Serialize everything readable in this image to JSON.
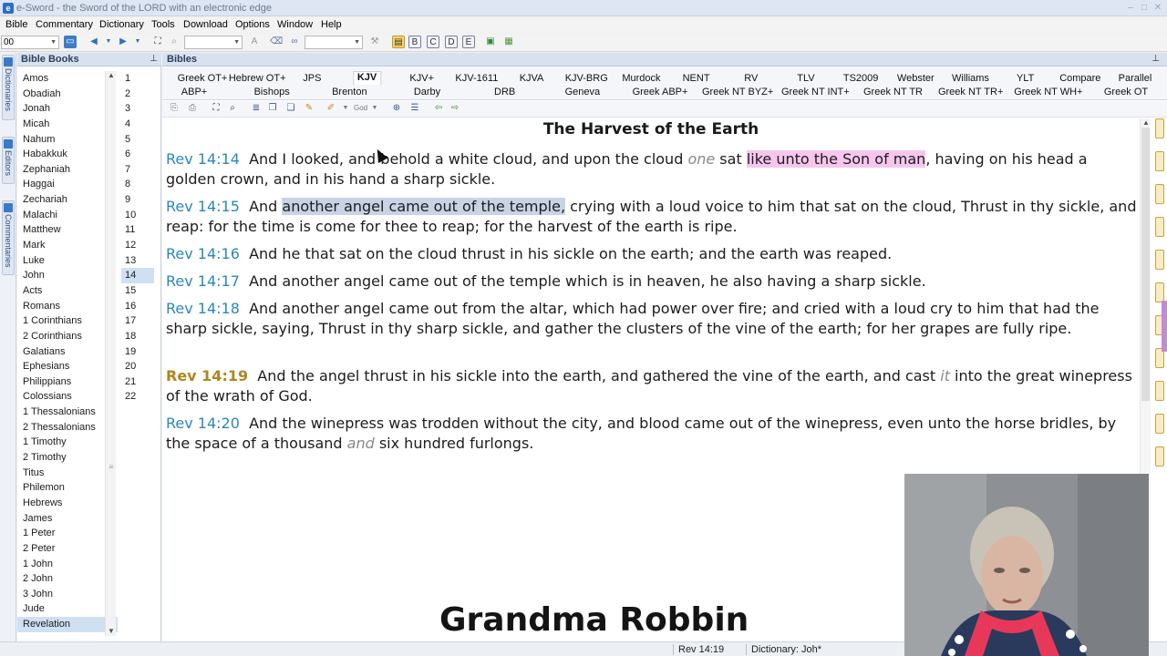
{
  "window": {
    "title": "e-Sword - the Sword of the LORD with an electronic edge",
    "controls": [
      "–",
      "□",
      "✕"
    ]
  },
  "menu": [
    "Bible",
    "Commentary",
    "Dictionary",
    "Tools",
    "Download",
    "Options",
    "Window",
    "Help"
  ],
  "toolbar": {
    "chapter_combo": "00",
    "search_combo": "",
    "translation_combo": ""
  },
  "side_tabs": [
    "Dictionaries",
    "Editors",
    "Commentaries"
  ],
  "book_panel": {
    "title": "Bible Books",
    "books": [
      "Amos",
      "Obadiah",
      "Jonah",
      "Micah",
      "Nahum",
      "Habakkuk",
      "Zephaniah",
      "Haggai",
      "Zechariah",
      "Malachi",
      "Matthew",
      "Mark",
      "Luke",
      "John",
      "Acts",
      "Romans",
      "1 Corinthians",
      "2 Corinthians",
      "Galatians",
      "Ephesians",
      "Philippians",
      "Colossians",
      "1 Thessalonians",
      "2 Thessalonians",
      "1 Timothy",
      "2 Timothy",
      "Titus",
      "Philemon",
      "Hebrews",
      "James",
      "1 Peter",
      "2 Peter",
      "1 John",
      "2 John",
      "3 John",
      "Jude",
      "Revelation"
    ],
    "selected_book": "Revelation",
    "chapters": [
      "1",
      "2",
      "3",
      "4",
      "5",
      "6",
      "7",
      "8",
      "9",
      "10",
      "11",
      "12",
      "13",
      "14",
      "15",
      "16",
      "17",
      "18",
      "19",
      "20",
      "21",
      "22"
    ],
    "selected_chapter": "14"
  },
  "bible_panel": {
    "title": "Bibles",
    "tabs_row1": [
      "Greek OT+",
      "Hebrew OT+",
      "JPS",
      "KJV",
      "KJV+",
      "KJV-1611",
      "KJVA",
      "KJV-BRG",
      "Murdock",
      "NENT",
      "RV",
      "TLV",
      "TS2009",
      "Webster",
      "Williams",
      "YLT",
      "Compare",
      "Parallel"
    ],
    "tabs_row2": [
      "ABP+",
      "Bishops",
      "Brenton",
      "Darby",
      "DRB",
      "Geneva",
      "Greek ABP+",
      "Greek NT BYZ+",
      "Greek NT INT+",
      "Greek NT TR",
      "Greek NT TR+",
      "Greek NT WH+",
      "Greek OT"
    ],
    "active_tab": "KJV",
    "heading": "The Harvest of the Earth",
    "verses": [
      {
        "ref": "Rev 14:14",
        "p1": "And I looked, and behold a white cloud, and upon the cloud ",
        "i1": "one",
        "p2": " sat ",
        "hl": "like unto the Son of man",
        "p3": ", having on his head a golden crown, and in his hand a sharp sickle."
      },
      {
        "ref": "Rev 14:15",
        "p1": "And ",
        "hl": "another angel came out of the temple,",
        "p2": " crying with a loud voice to him that sat on the cloud, Thrust in thy sickle, and reap: for the time is come for thee to reap; for the harvest of the earth is ripe."
      },
      {
        "ref": "Rev 14:16",
        "text": "And he that sat on the cloud thrust in his sickle on the earth; and the earth was reaped."
      },
      {
        "ref": "Rev 14:17",
        "text": "And another angel came out of the temple which is in heaven, he also having a sharp sickle."
      },
      {
        "ref": "Rev 14:18",
        "text": "And another angel came out from the altar, which had power over fire; and cried with a loud cry to him that had the sharp sickle, saying, Thrust in thy sharp sickle, and gather the clusters of the vine of the earth; for her grapes are fully ripe."
      },
      {
        "ref": "Rev 14:19",
        "p1": "And the angel thrust in his sickle into the earth, and gathered the vine of the earth, and cast ",
        "i1": "it",
        "p2": " into the great winepress of the wrath of God."
      },
      {
        "ref": "Rev 14:20",
        "p1": "And the winepress was trodden without the city, and blood came out of the winepress, even unto the horse bridles, by the space of a thousand ",
        "i1": "and",
        "p2": " six hundred furlongs."
      }
    ]
  },
  "status": {
    "reference": "Rev 14:19",
    "dictionary": "Dictionary: Joh*"
  },
  "overlay": {
    "caption": "Grandma Robbin"
  },
  "colors": {
    "verse_ref": "#2a86c2",
    "current_ref": "#b3851a",
    "highlight_pink": "#f6c6ee",
    "highlight_blue": "#c8d3e6"
  }
}
